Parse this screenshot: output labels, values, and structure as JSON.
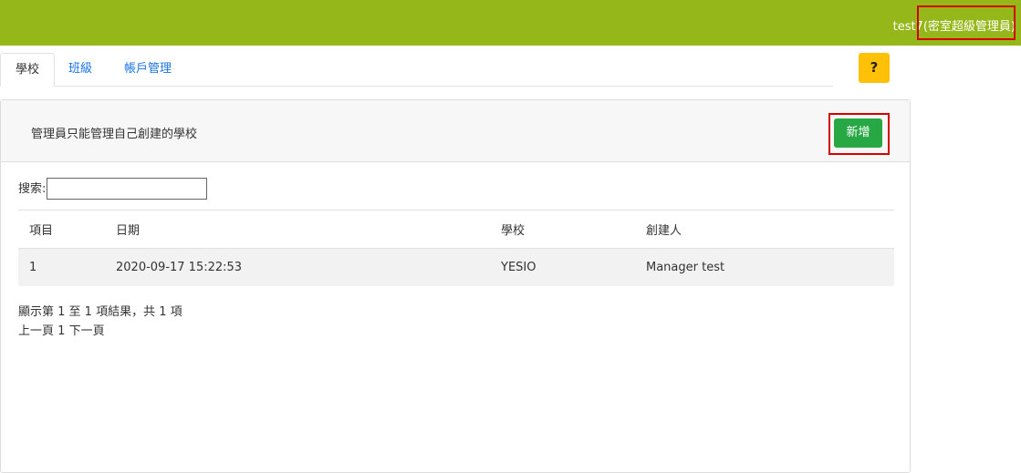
{
  "header": {
    "user_name": "test7",
    "user_role": "(密室超級管理員)"
  },
  "tabs": [
    {
      "label": "學校",
      "active": true
    },
    {
      "label": "班級",
      "active": false
    },
    {
      "label": "帳戶管理",
      "active": false
    }
  ],
  "help": {
    "label": "?"
  },
  "panel": {
    "title": "管理員只能管理自己創建的學校",
    "add_label": "新增"
  },
  "search": {
    "label": "搜索:",
    "value": ""
  },
  "table": {
    "columns": [
      "項目",
      "日期",
      "學校",
      "創建人"
    ],
    "rows": [
      [
        "1",
        "2020-09-17 15:22:53",
        "YESIO",
        "Manager test"
      ]
    ]
  },
  "info_text": "顯示第 1 至 1 項結果，共 1 項",
  "pager": {
    "prev": "上一頁",
    "current": "1",
    "next": "下一頁"
  },
  "colors": {
    "topbar": "#95b719",
    "add_button": "#28a745",
    "help_button": "#ffc107",
    "highlight": "#d40000",
    "link": "#1a73e8"
  }
}
